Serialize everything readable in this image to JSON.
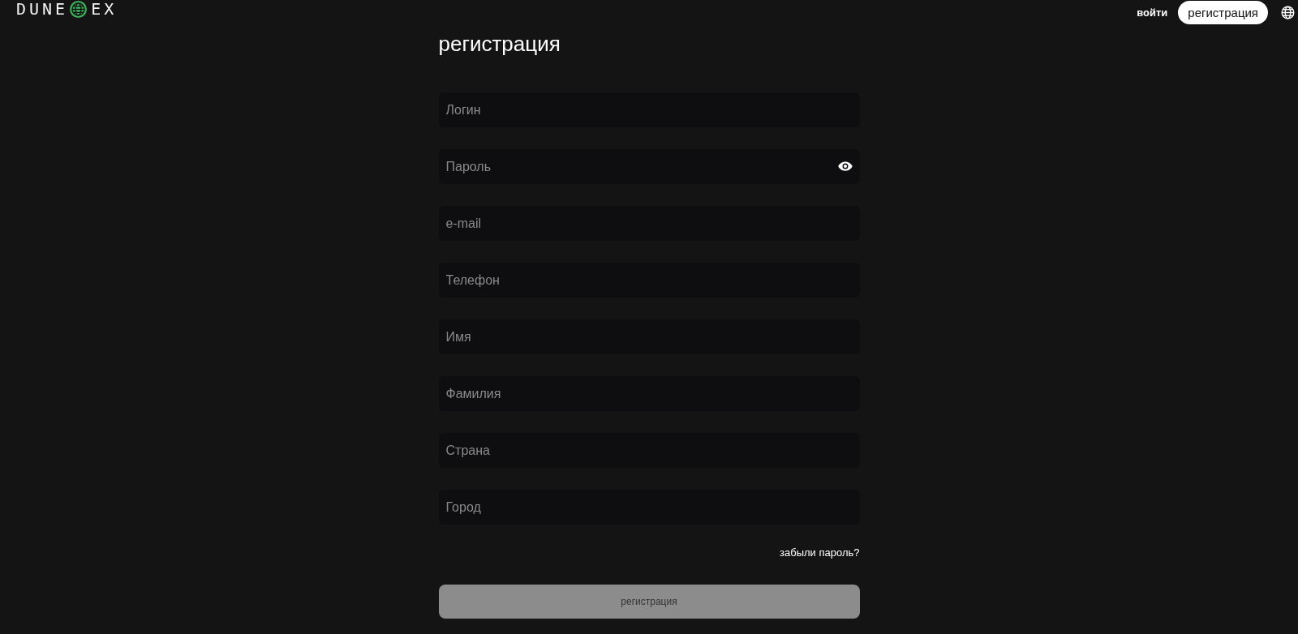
{
  "header": {
    "logo": {
      "left": "DUNE",
      "right": "EX"
    },
    "nav": [
      {
        "label": "войти",
        "kind": "link"
      },
      {
        "label": "регистрация",
        "kind": "button"
      }
    ]
  },
  "form": {
    "title": "регистрация",
    "fields": [
      {
        "placeholder": "Логин",
        "kind": "text"
      },
      {
        "placeholder": "Пароль",
        "kind": "password"
      },
      {
        "placeholder": "e-mail",
        "kind": "text"
      },
      {
        "placeholder": "Телефон",
        "kind": "text"
      },
      {
        "placeholder": "Имя",
        "kind": "text"
      },
      {
        "placeholder": "Фамилия",
        "kind": "text"
      },
      {
        "placeholder": "Страна",
        "kind": "text"
      },
      {
        "placeholder": "Город",
        "kind": "text"
      }
    ],
    "forgot_link": "забыли пароль?",
    "submit": {
      "label": "регистрация",
      "disabled": true
    }
  }
}
